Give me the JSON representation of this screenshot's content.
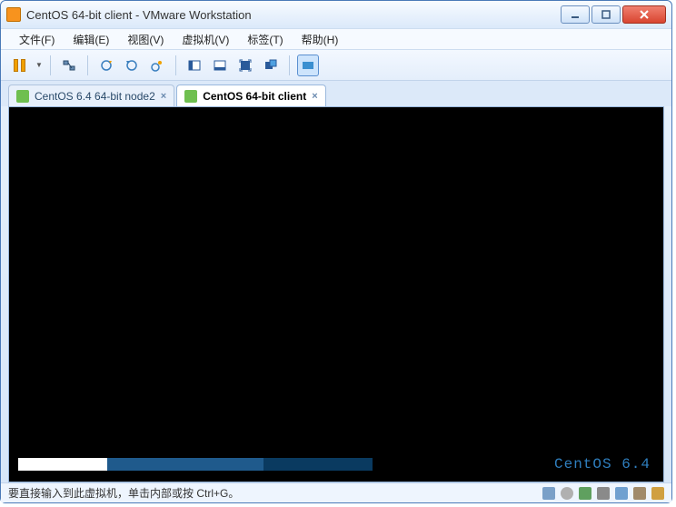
{
  "window": {
    "title": "CentOS 64-bit client - VMware Workstation"
  },
  "menu": {
    "file": "文件(F)",
    "edit": "编辑(E)",
    "view": "视图(V)",
    "vm": "虚拟机(V)",
    "tags": "标签(T)",
    "help": "帮助(H)"
  },
  "tabs": [
    {
      "label": "CentOS 6.4 64-bit node2",
      "active": false
    },
    {
      "label": "CentOS 64-bit client",
      "active": true
    }
  ],
  "boot": {
    "os_label": "CentOS 6.4"
  },
  "status": {
    "hint": "要直接输入到此虚拟机，单击内部或按 Ctrl+G。"
  },
  "colors": {
    "accent": "#1f5a8c",
    "accent_dark": "#0a3a60",
    "boot_text": "#2f7fbf"
  }
}
